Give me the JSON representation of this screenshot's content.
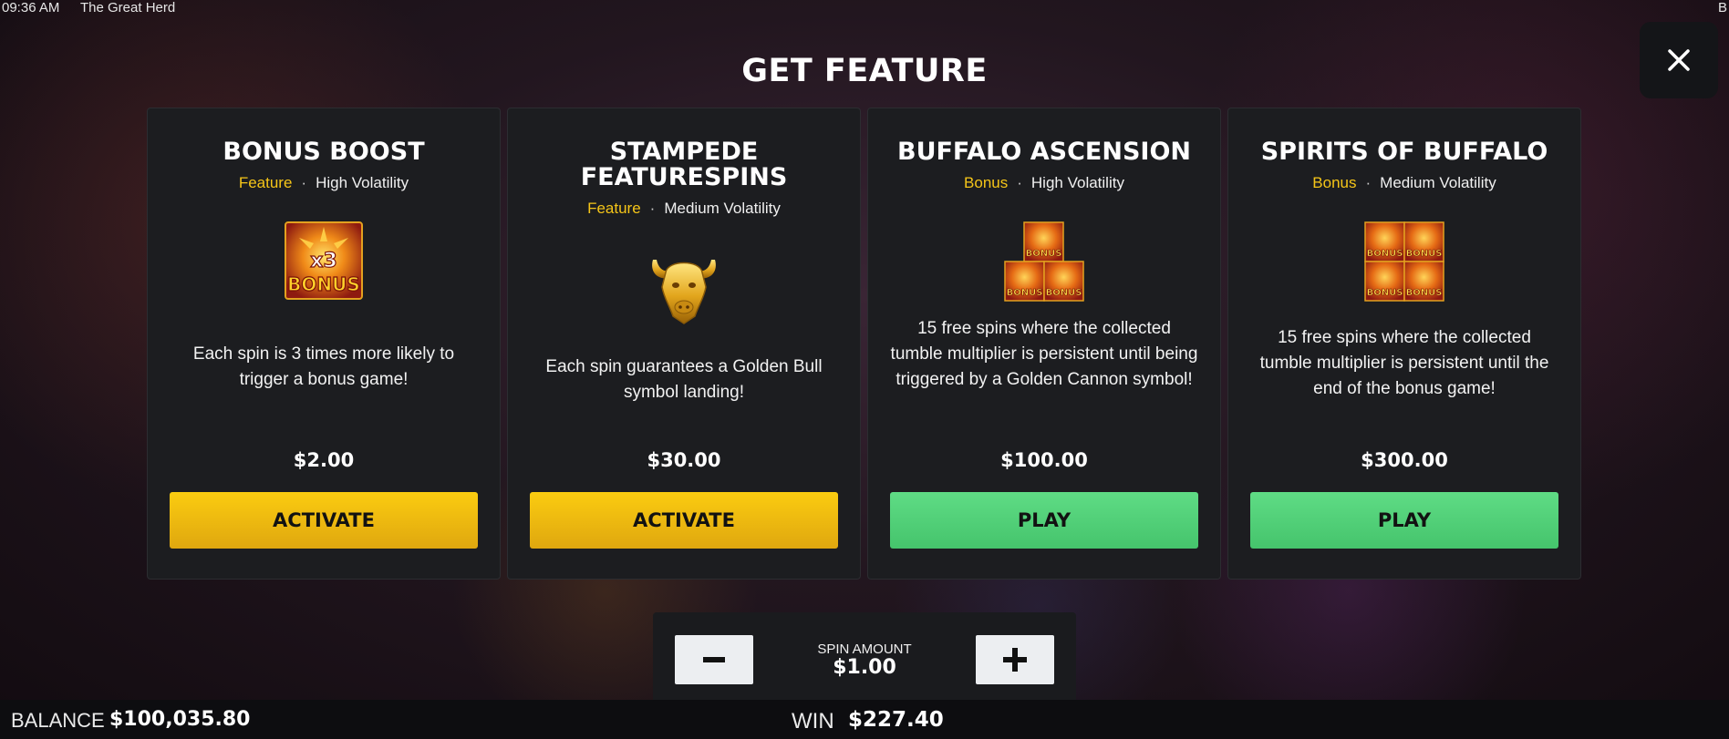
{
  "status_bar": {
    "time": "09:36 AM",
    "game_title": "The Great Herd",
    "corner_label": "B"
  },
  "modal": {
    "title": "GET FEATURE",
    "close_icon": "close-icon"
  },
  "cards": [
    {
      "title": "BONUS BOOST",
      "kind": "Feature",
      "volatility": "High Volatility",
      "icon_text_top": "x3",
      "icon_text_bottom": "BONUS",
      "description": "Each spin is 3 times more likely to trigger a bonus game!",
      "price": "$2.00",
      "button": "ACTIVATE"
    },
    {
      "title": "STAMPEDE FEATURESPINS",
      "kind": "Feature",
      "volatility": "Medium Volatility",
      "icon": "golden-bull-icon",
      "description": "Each spin guarantees a Golden Bull symbol landing!",
      "price": "$30.00",
      "button": "ACTIVATE"
    },
    {
      "title": "BUFFALO ASCENSION",
      "kind": "Bonus",
      "volatility": "High Volatility",
      "icon_tile_text": "BONUS",
      "description": "15 free spins where the collected tumble multiplier is persistent until being triggered by a Golden Cannon symbol!",
      "price": "$100.00",
      "button": "PLAY"
    },
    {
      "title": "SPIRITS OF BUFFALO",
      "kind": "Bonus",
      "volatility": "Medium Volatility",
      "icon_tile_text": "BONUS",
      "description": "15 free spins where the collected tumble multiplier is persistent until the end of the bonus game!",
      "price": "$300.00",
      "button": "PLAY"
    }
  ],
  "spin": {
    "label": "SPIN AMOUNT",
    "value": "$1.00",
    "minus_icon": "minus-icon",
    "plus_icon": "plus-icon"
  },
  "footer": {
    "balance_label": "BALANCE",
    "balance_value": "$100,035.80",
    "win_label": "WIN",
    "win_value": "$227.40"
  },
  "colors": {
    "accent_yellow": "#f5c518",
    "play_green": "#4fd176",
    "card_bg": "#1c1d20"
  }
}
